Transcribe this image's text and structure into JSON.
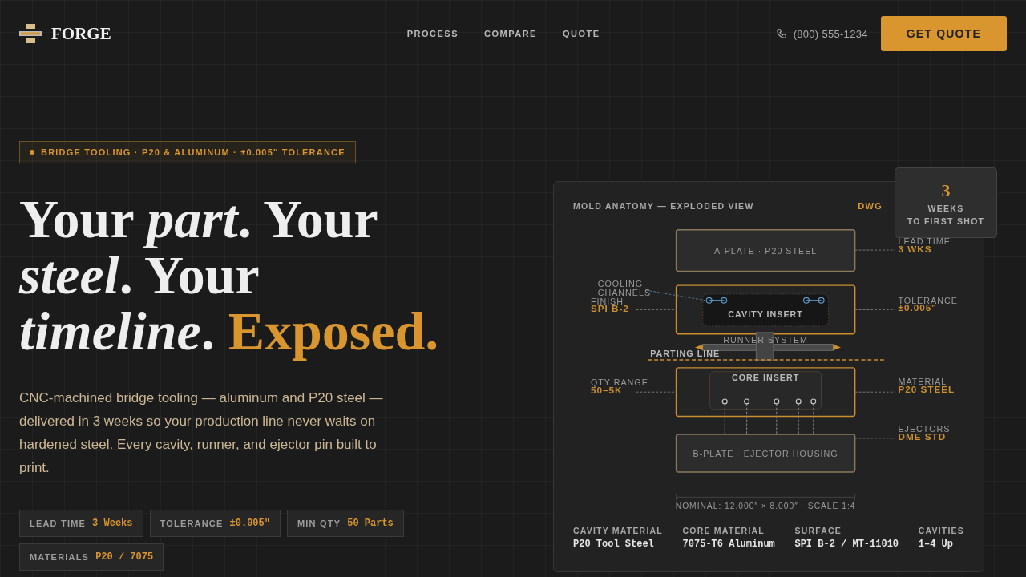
{
  "nav": {
    "logo": "FORGE",
    "links": [
      "PROCESS",
      "COMPARE",
      "QUOTE"
    ],
    "phone": "(800) 555-1234",
    "cta": "GET QUOTE"
  },
  "hero": {
    "tag": "BRIDGE TOOLING · P20 & ALUMINUM · ±0.005″ TOLERANCE",
    "headline": "Your *part*. Your *steel*. Your *timeline*.",
    "accent": "Exposed.",
    "description": "CNC-machined bridge tooling — aluminum and P20 steel — delivered in 3 weeks so your production line never waits on hardened steel. Every cavity, runner, and ejector pin built to print.",
    "specs": [
      {
        "label": "LEAD TIME",
        "value": "3 Weeks"
      },
      {
        "label": "TOLERANCE",
        "value": "±0.005\""
      },
      {
        "label": "MIN QTY",
        "value": "50 Parts"
      },
      {
        "label": "MATERIALS",
        "value": "P20 / 7075"
      }
    ]
  },
  "diagram": {
    "title": "MOLD ANATOMY — EXPLODED VIEW",
    "drawing_no": "DWG",
    "badge": {
      "number": "3",
      "line_1": "WEEKS",
      "line_2": "TO FIRST SHOT"
    },
    "parts": {
      "a_plate": "A-PLATE · P20 STEEL",
      "cavity_insert": "CAVITY INSERT",
      "runner": "RUNNER SYSTEM",
      "parting_line": "PARTING LINE",
      "core_insert": "CORE INSERT",
      "b_plate": "B-PLATE · EJECTOR HOUSING",
      "cooling": [
        "COOLING",
        "CHANNELS"
      ]
    },
    "left_callouts": [
      {
        "label": "FINISH",
        "value": "SPI B-2"
      },
      {
        "label": "QTY RANGE",
        "value": "50–5K"
      }
    ],
    "right_callouts": [
      {
        "label": "LEAD TIME",
        "value": "3 WKS"
      },
      {
        "label": "TOLERANCE",
        "value": "±0.005″"
      },
      {
        "label": "MATERIAL",
        "value": "P20 STEEL"
      },
      {
        "label": "EJECTORS",
        "value": "DME STD"
      }
    ],
    "nominal": "NOMINAL: 12.000″ × 8.000″ · SCALE 1:4",
    "specs": [
      {
        "label": "CAVITY MATERIAL",
        "value": "P20 Tool Steel"
      },
      {
        "label": "CORE MATERIAL",
        "value": "7075-T6 Aluminum"
      },
      {
        "label": "SURFACE",
        "value": "SPI B-2 / MT-11010"
      },
      {
        "label": "CAVITIES",
        "value": "1–4 Up"
      }
    ]
  }
}
